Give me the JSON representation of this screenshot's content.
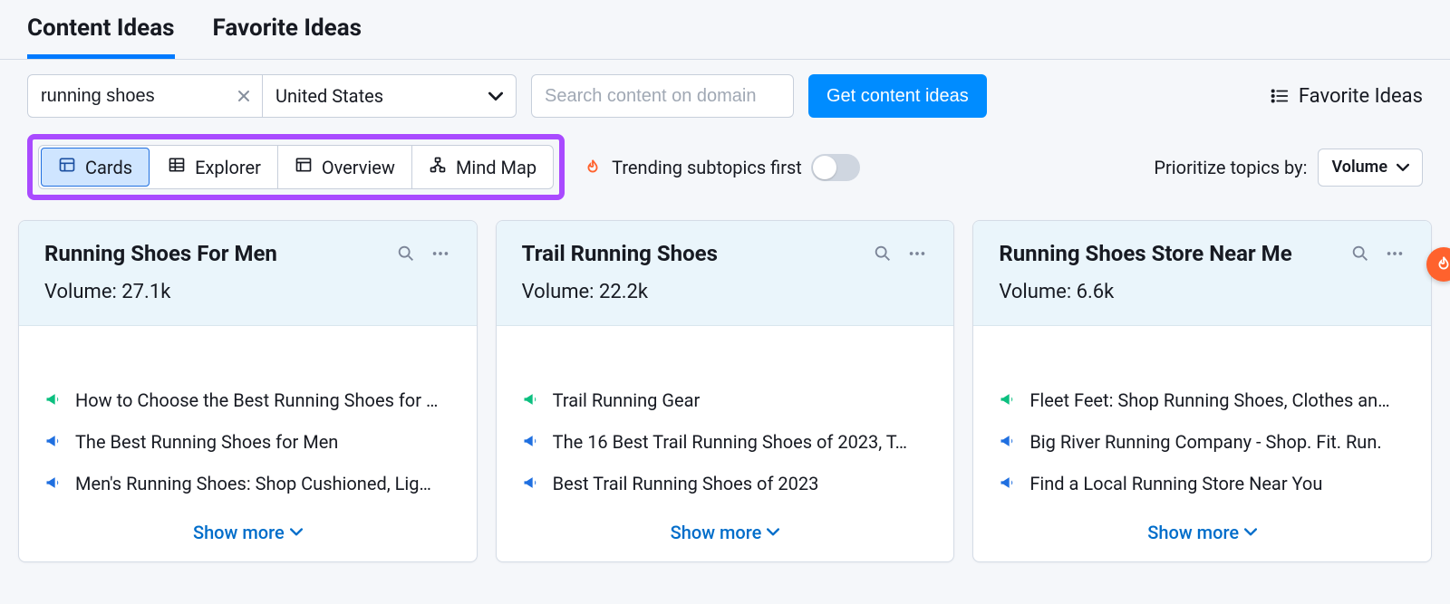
{
  "tabs": {
    "items": [
      {
        "label": "Content Ideas"
      },
      {
        "label": "Favorite Ideas"
      }
    ],
    "active_index": 0
  },
  "query": {
    "value": "running shoes",
    "country": "United States"
  },
  "domain_search": {
    "placeholder": "Search content on domain"
  },
  "cta_label": "Get content ideas",
  "favorite_link_label": "Favorite Ideas",
  "views": {
    "items": [
      {
        "label": "Cards"
      },
      {
        "label": "Explorer"
      },
      {
        "label": "Overview"
      },
      {
        "label": "Mind Map"
      }
    ],
    "active_index": 0
  },
  "trending_label": "Trending subtopics first",
  "prioritize_label": "Prioritize topics by:",
  "prioritize_value": "Volume",
  "cards": [
    {
      "title": "Running Shoes For Men",
      "volume_label": "Volume:",
      "volume_value": "27.1k",
      "ideas": [
        {
          "color": "green",
          "text": "How to Choose the Best Running Shoes for …"
        },
        {
          "color": "blue",
          "text": "The Best Running Shoes for Men"
        },
        {
          "color": "blue",
          "text": "Men's Running Shoes: Shop Cushioned, Lig…"
        }
      ],
      "show_more": "Show more"
    },
    {
      "title": "Trail Running Shoes",
      "volume_label": "Volume:",
      "volume_value": "22.2k",
      "ideas": [
        {
          "color": "green",
          "text": "Trail Running Gear"
        },
        {
          "color": "blue",
          "text": "The 16 Best Trail Running Shoes of 2023, T…"
        },
        {
          "color": "blue",
          "text": "Best Trail Running Shoes of 2023"
        }
      ],
      "show_more": "Show more"
    },
    {
      "title": "Running Shoes Store Near Me",
      "volume_label": "Volume:",
      "volume_value": "6.6k",
      "ideas": [
        {
          "color": "green",
          "text": "Fleet Feet: Shop Running Shoes, Clothes an…"
        },
        {
          "color": "blue",
          "text": "Big River Running Company - Shop. Fit. Run."
        },
        {
          "color": "blue",
          "text": "Find a Local Running Store Near You"
        }
      ],
      "show_more": "Show more"
    }
  ]
}
